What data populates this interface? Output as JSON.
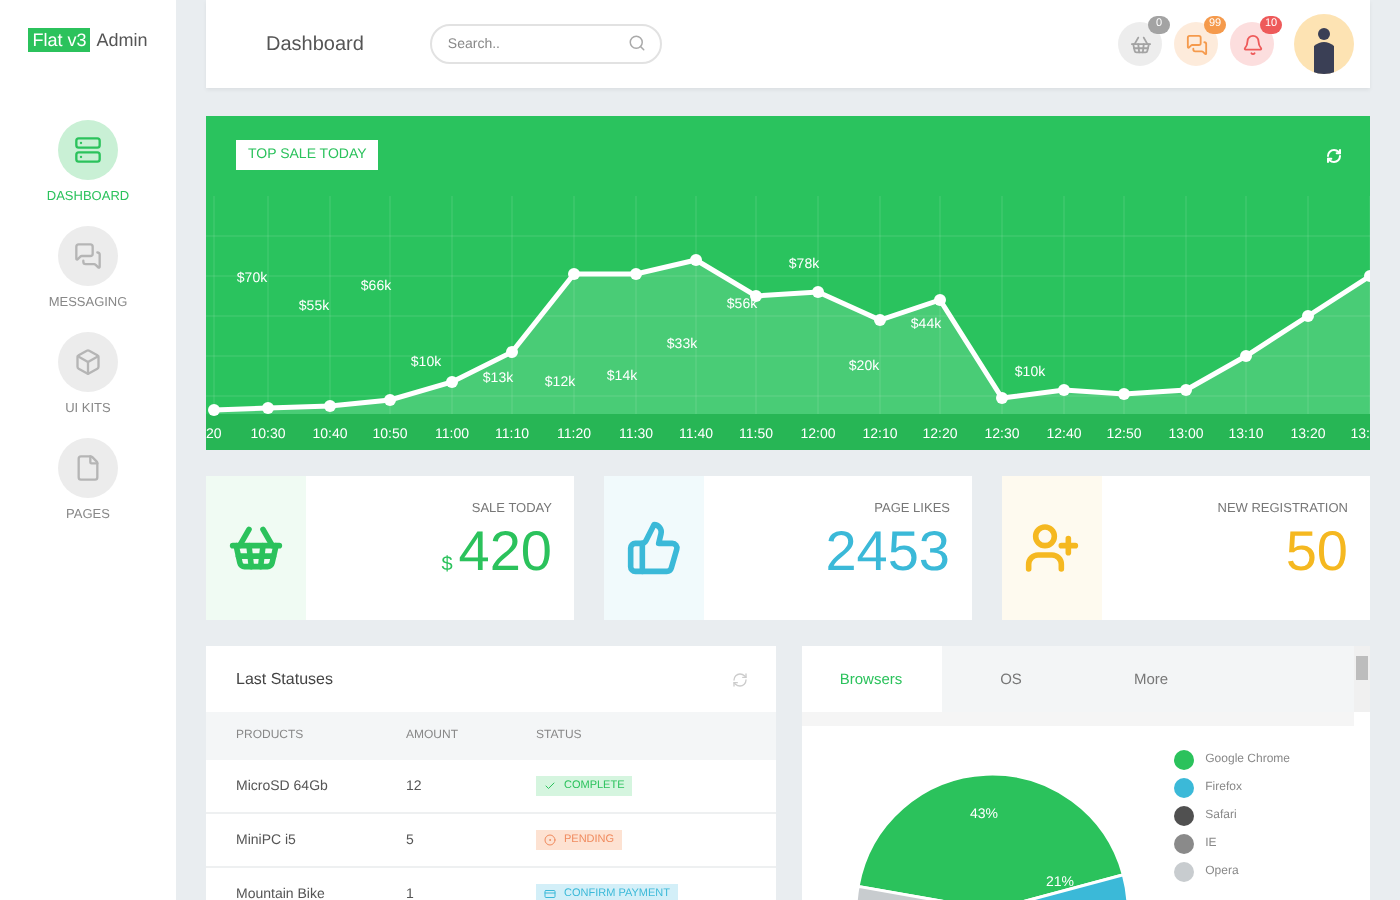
{
  "brand": {
    "badge": "Flat v3",
    "name": "Admin"
  },
  "sidebar": {
    "items": [
      {
        "kind": "dashboard",
        "label": "DASHBOARD",
        "selected": true
      },
      {
        "kind": "messaging",
        "label": "MESSAGING",
        "selected": false
      },
      {
        "kind": "kits",
        "label": "UI KITS",
        "selected": false
      },
      {
        "kind": "pages",
        "label": "PAGES",
        "selected": false
      }
    ]
  },
  "header": {
    "title": "Dashboard",
    "search": {
      "placeholder": "Search.."
    },
    "notifications": [
      {
        "kind": "cart",
        "count": "0",
        "color": "#a3a3a3"
      },
      {
        "kind": "messages",
        "count": "99",
        "color": "#f59a4c"
      },
      {
        "kind": "alerts",
        "count": "10",
        "color": "#ee5a5a"
      }
    ]
  },
  "sales_chart": {
    "title": "TOP SALE TODAY",
    "x_labels": [
      "20",
      "10:30",
      "10:40",
      "10:50",
      "11:00",
      "11:10",
      "11:20",
      "11:30",
      "11:40",
      "11:50",
      "12:00",
      "12:10",
      "12:20",
      "12:30",
      "12:40",
      "12:50",
      "13:00",
      "13:10",
      "13:20",
      "13:"
    ],
    "value_labels": [
      "$70k",
      "$55k",
      "$66k",
      "$10k",
      "$13k",
      "$12k",
      "$14k",
      "$33k",
      "$56k",
      "$78k",
      "$20k",
      "$44k",
      "$10k"
    ]
  },
  "stats": [
    {
      "kind": "basket",
      "label": "SALE TODAY",
      "prefix": "$",
      "value": "420",
      "color": "#2bc25c"
    },
    {
      "kind": "likes",
      "label": "PAGE LIKES",
      "value": "2453",
      "color": "#3bb9d8"
    },
    {
      "kind": "users",
      "label": "NEW REGISTRATION",
      "value": "50",
      "color": "#f5b820"
    }
  ],
  "statuses": {
    "title": "Last Statuses",
    "columns": [
      "PRODUCTS",
      "AMOUNT",
      "STATUS"
    ],
    "rows": [
      {
        "product": "MicroSD 64Gb",
        "amount": "12",
        "status": {
          "kind": "complete",
          "label": "COMPLETE"
        }
      },
      {
        "product": "MiniPC i5",
        "amount": "5",
        "status": {
          "kind": "pending",
          "label": "PENDING"
        }
      },
      {
        "product": "Mountain Bike",
        "amount": "1",
        "status": {
          "kind": "confirm",
          "label": "CONFIRM PAYMENT"
        }
      }
    ]
  },
  "browsers": {
    "tabs": [
      {
        "label": "Browsers",
        "selected": true
      },
      {
        "label": "OS",
        "selected": false
      },
      {
        "label": "More",
        "selected": false
      }
    ],
    "slice_labels": [
      "43%",
      "21%"
    ],
    "legend": [
      {
        "label": "Google Chrome",
        "color": "#2bc25c"
      },
      {
        "label": "Firefox",
        "color": "#3bb9d8"
      },
      {
        "label": "Safari",
        "color": "#505050"
      },
      {
        "label": "IE",
        "color": "#8a8a8a"
      },
      {
        "label": "Opera",
        "color": "#c8cccf"
      }
    ]
  }
}
